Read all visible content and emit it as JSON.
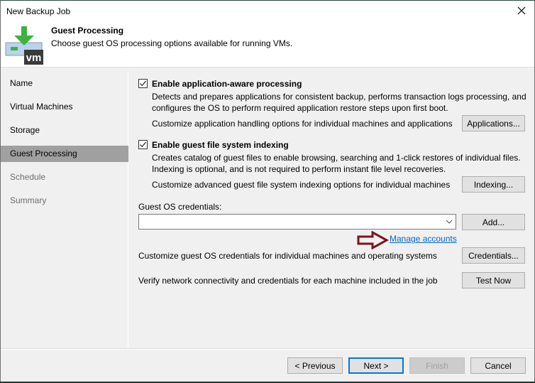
{
  "window": {
    "title": "New Backup Job",
    "close_icon": "close-icon"
  },
  "header": {
    "icon": "vm-backup-icon",
    "icon_label": "vm",
    "title": "Guest Processing",
    "subtitle": "Choose guest OS processing options available for running VMs."
  },
  "sidebar": {
    "items": [
      {
        "label": "Name",
        "state": "normal"
      },
      {
        "label": "Virtual Machines",
        "state": "normal"
      },
      {
        "label": "Storage",
        "state": "normal"
      },
      {
        "label": "Guest Processing",
        "state": "active"
      },
      {
        "label": "Schedule",
        "state": "disabled"
      },
      {
        "label": "Summary",
        "state": "disabled"
      }
    ]
  },
  "main": {
    "app_aware": {
      "checked": true,
      "label": "Enable application-aware processing",
      "desc_line1": "Detects and prepares applications for consistent backup, performs transaction logs processing, and",
      "desc_line2": "configures the OS to perform required application restore steps upon first boot.",
      "customize_text": "Customize application handling options for individual machines and applications",
      "button": "Applications..."
    },
    "indexing": {
      "checked": true,
      "label": "Enable guest file system indexing",
      "desc_line1": "Creates catalog of guest files to enable browsing, searching and 1-click restores of individual files.",
      "desc_line2": "Indexing is optional, and is not required to perform instant file level recoveries.",
      "customize_text": "Customize advanced guest file system indexing options for individual machines",
      "button": "Indexing..."
    },
    "credentials": {
      "label": "Guest OS credentials:",
      "value": "",
      "add_button": "Add...",
      "manage_link": "Manage accounts",
      "customize_text": "Customize guest OS credentials for individual machines and operating systems",
      "credentials_button": "Credentials...",
      "verify_text": "Verify network connectivity and credentials for each machine included in the job",
      "test_button": "Test Now"
    },
    "annotation": {
      "icon": "arrow-right-icon",
      "color": "#7a1520"
    }
  },
  "footer": {
    "previous": "< Previous",
    "next": "Next >",
    "finish": "Finish",
    "cancel": "Cancel"
  },
  "colors": {
    "accent": "#0078d7",
    "link": "#0066cc",
    "active_nav": "#a0a0a0",
    "icon_green": "#3db33d"
  }
}
